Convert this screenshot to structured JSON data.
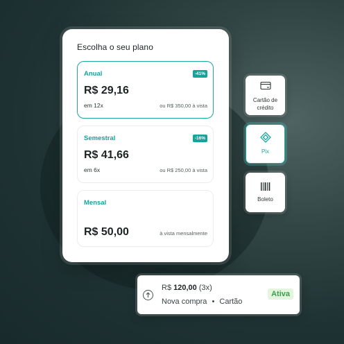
{
  "panel": {
    "title": "Escolha o seu plano"
  },
  "plans": [
    {
      "name": "Anual",
      "badge": "-41%",
      "price": "R$ 29,16",
      "installment": "em 12x",
      "note": "ou R$ 350,00 à vista",
      "selected": true
    },
    {
      "name": "Semestral",
      "badge": "-16%",
      "price": "R$ 41,66",
      "installment": "em 6x",
      "note": "ou R$ 250,00 à vista",
      "selected": false
    },
    {
      "name": "Mensal",
      "price": "R$ 50,00",
      "note": "à vista mensalmente",
      "selected": false
    }
  ],
  "payment_methods": [
    {
      "label": "Cartão de crédito",
      "icon": "credit-card-icon",
      "selected": false
    },
    {
      "label": "Pix",
      "icon": "pix-icon",
      "selected": true
    },
    {
      "label": "Boleto",
      "icon": "barcode-icon",
      "selected": false
    }
  ],
  "subscription": {
    "currency": "R$",
    "amount": "120,00",
    "installments": "(3x)",
    "description": "Nova compra",
    "separator": "•",
    "method": "Cartão",
    "status": "Ativa",
    "icon": "arrow-up-circle-icon"
  },
  "colors": {
    "accent": "#17a399",
    "status_bg": "#e3f5df",
    "status_text": "#3aa14a"
  }
}
